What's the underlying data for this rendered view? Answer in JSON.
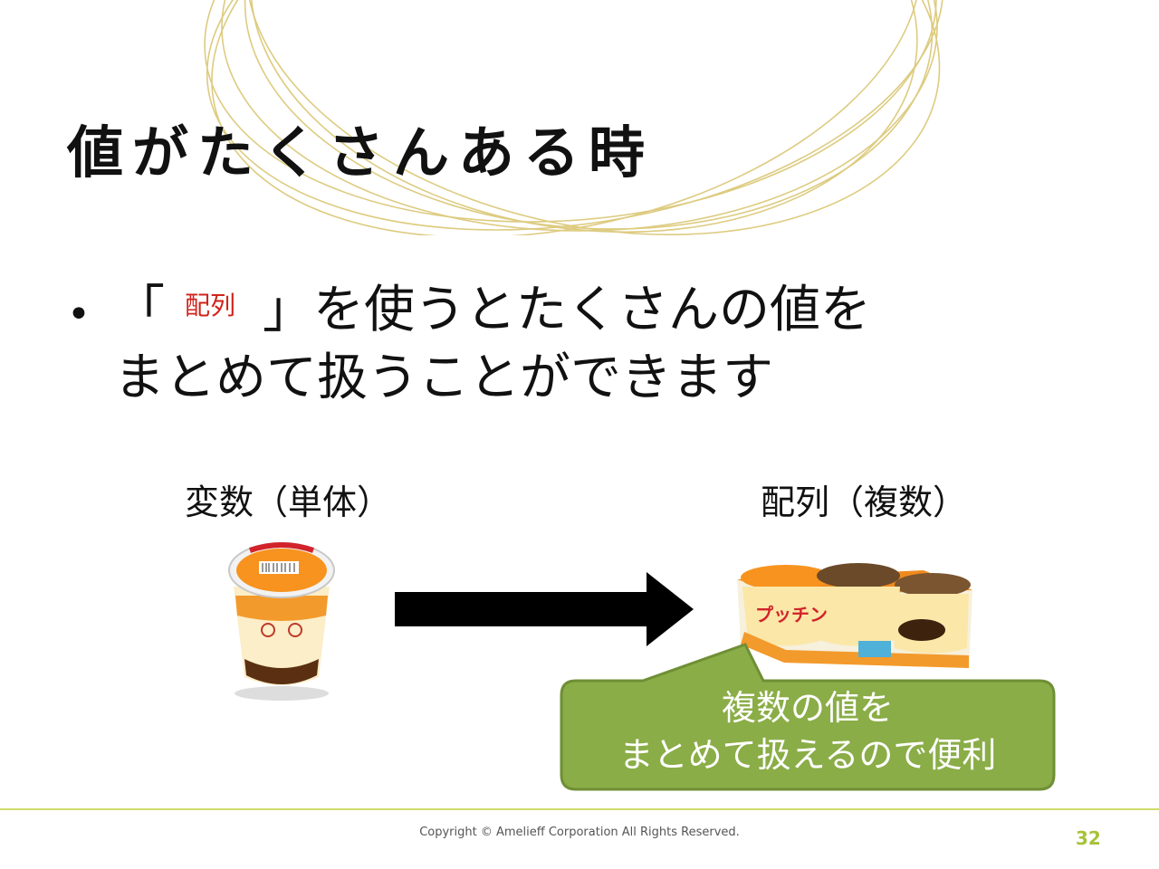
{
  "slide": {
    "title": "値がたくさんある時",
    "bullet": {
      "open_bracket": "「",
      "term": "配列",
      "close_rest": "」を使うとたくさんの値を",
      "line2": "まとめて扱うことができます"
    },
    "label_left": "変数（単体）",
    "label_right": "配列（複数）",
    "callout": {
      "line1": "複数の値を",
      "line2": "まとめて扱えるので便利"
    },
    "footer": {
      "copyright": "Copyright © Amelieff Corporation All Rights Reserved.",
      "page_number": "32"
    }
  },
  "colors": {
    "accent_green": "#8aad47",
    "callout_border": "#6f8f35",
    "term_red": "#d0231b",
    "page_number": "#a6c23a",
    "deco_gold": "#d8c36a"
  },
  "icons": {
    "single_item": "pudding-cup-icon",
    "multi_item": "pudding-three-pack-icon",
    "arrow": "right-arrow-icon"
  }
}
